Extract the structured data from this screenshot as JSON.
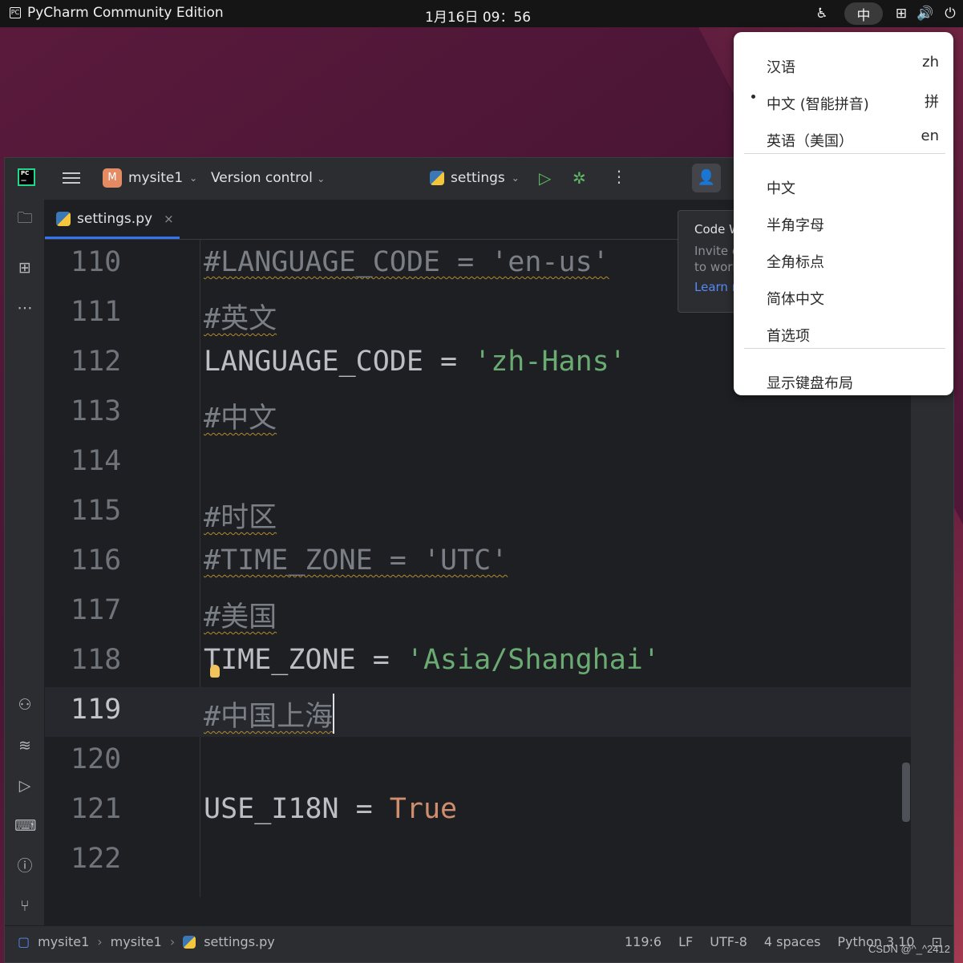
{
  "topbar": {
    "app_name": "PyCharm Community Edition",
    "clock": "1月16日  09：56",
    "ime_indicator": "中"
  },
  "ide": {
    "project_badge": "M",
    "project_name": "mysite1",
    "version_control": "Version control",
    "run_config": "settings",
    "tab_file": "settings.py",
    "tab_close": "×"
  },
  "editor": {
    "lines": [
      {
        "num": "110"
      },
      {
        "num": "111"
      },
      {
        "num": "112"
      },
      {
        "num": "113"
      },
      {
        "num": "114"
      },
      {
        "num": "115"
      },
      {
        "num": "116"
      },
      {
        "num": "117"
      },
      {
        "num": "118"
      },
      {
        "num": "119"
      },
      {
        "num": "120"
      },
      {
        "num": "121"
      },
      {
        "num": "122"
      }
    ],
    "tokens": {
      "l110": "#LANGUAGE_CODE = 'en-us'",
      "l111": "#英文",
      "l112_id": "LANGUAGE_CODE = ",
      "l112_str": "'zh-Hans'",
      "l113": "#中文",
      "l115": "#时区",
      "l116": "#TIME_ZONE = 'UTC'",
      "l117": "#美国",
      "l118_id": "TIME_ZONE = ",
      "l118_str": "'Asia/Shanghai'",
      "l119": "#中国上海",
      "l121_id": "USE_I18N = ",
      "l121_kw": "True"
    }
  },
  "code_with_me": {
    "title": "Code W",
    "desc1": "Invite c",
    "desc2": "to work",
    "link": "Learn m"
  },
  "statusbar": {
    "crumb1": "mysite1",
    "crumb2": "mysite1",
    "crumb3": "settings.py",
    "position": "119:6",
    "line_sep": "LF",
    "encoding": "UTF-8",
    "indent": "4 spaces",
    "interpreter": "Python 3.10"
  },
  "ime_menu": {
    "items": [
      {
        "label": "汉语",
        "shortcut": "zh"
      },
      {
        "label": "中文 (智能拼音)",
        "shortcut": "拼"
      },
      {
        "label": "英语（美国）",
        "shortcut": "en"
      },
      {
        "label": "中文"
      },
      {
        "label": "半角字母"
      },
      {
        "label": "全角标点"
      },
      {
        "label": "简体中文"
      },
      {
        "label": "首选项"
      },
      {
        "label": "显示键盘布局"
      }
    ]
  },
  "watermark": "CSDN @^_^2412",
  "colors": {
    "accent": "#3574f0",
    "string": "#6aab73",
    "keyword": "#cf8e6d",
    "comment": "#7a7e85"
  }
}
